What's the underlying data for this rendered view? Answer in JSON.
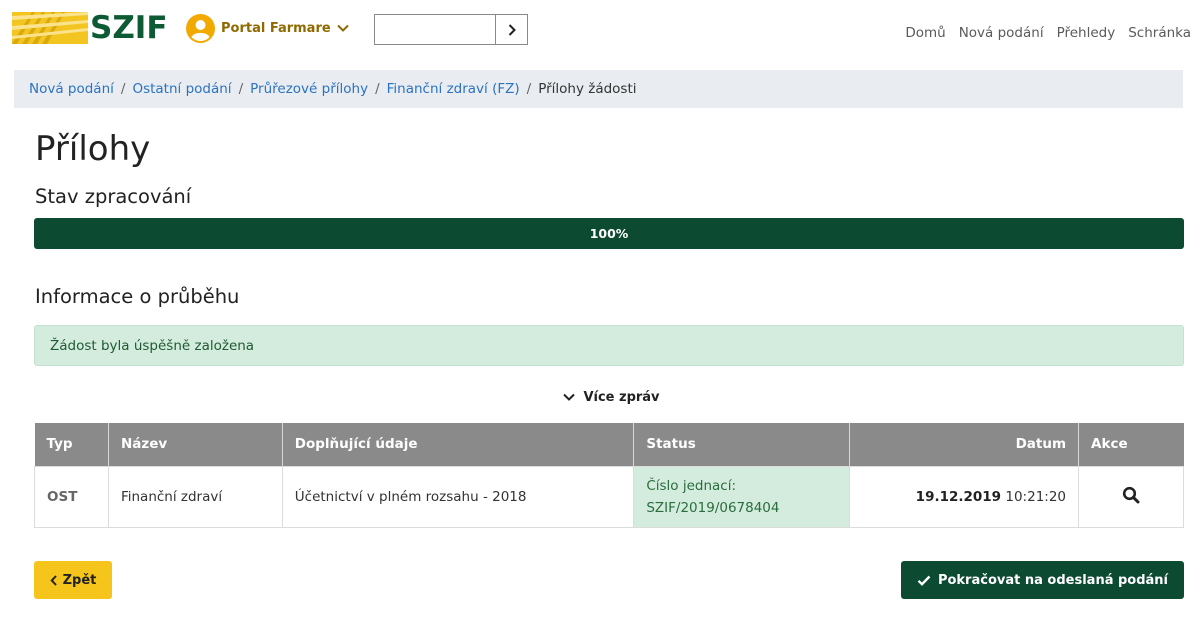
{
  "header": {
    "logo_text": "SZIF",
    "portal_label": "Portal Farmare",
    "search_value": "",
    "nav": [
      "Domů",
      "Nová podání",
      "Přehledy",
      "Schránka"
    ]
  },
  "breadcrumb": {
    "items": [
      "Nová podání",
      "Ostatní podání",
      "Průřezové přílohy",
      "Finanční zdraví (FZ)"
    ],
    "current": "Přílohy žádosti"
  },
  "page": {
    "title": "Přílohy",
    "status_title": "Stav zpracování",
    "progress_label": "100%",
    "progress_value": 100,
    "info_title": "Informace o průběhu",
    "alert_text": "Žádost byla úspěšně založena",
    "more_label": "Více zpráv"
  },
  "table": {
    "headers": [
      "Typ",
      "Název",
      "Doplňující údaje",
      "Status",
      "Datum",
      "Akce"
    ],
    "rows": [
      {
        "typ": "OST",
        "nazev": "Finanční zdraví",
        "doplnujici": "Účetnictví v plném rozsahu - 2018",
        "status_line1": "Číslo jednací:",
        "status_line2": "SZIF/2019/0678404",
        "datum_date": "19.12.2019",
        "datum_time": "10:21:20",
        "akce_icon": "search-icon"
      }
    ]
  },
  "buttons": {
    "back": "Zpět",
    "continue": "Pokračovat na odeslaná podání"
  },
  "colors": {
    "brand_green": "#0c4a32",
    "accent_yellow": "#f5c51c",
    "link_blue": "#2b72c2",
    "success_bg": "#d4ecdd"
  }
}
